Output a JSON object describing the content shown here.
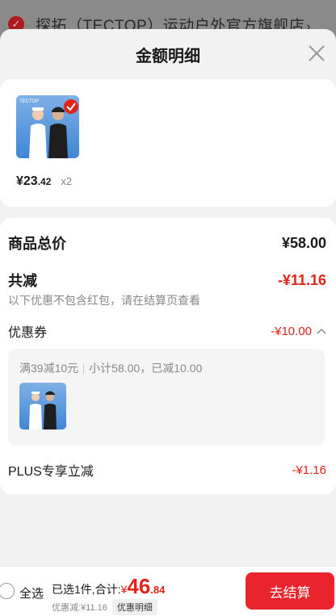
{
  "background_store": {
    "name": "探拓（TECTOP）运动户外官方旗舰店",
    "chevron": "›"
  },
  "sheet": {
    "title": "金额明细"
  },
  "product": {
    "price_main": "¥23",
    "price_decimal": ".42",
    "quantity": "x2",
    "thumb_brand": "TECTOP"
  },
  "summary": {
    "total_label": "商品总价",
    "total_value": "¥58.00",
    "reduce_label": "共减",
    "reduce_value": "-¥11.16",
    "note": "以下优惠不包含红包，请在结算页查看",
    "coupon_label": "优惠券",
    "coupon_value": "-¥10.00",
    "coupon_rule": "满39减10元",
    "coupon_subtotal": "小计58.00，已减10.00",
    "plus_label": "PLUS专享立减",
    "plus_value": "-¥1.16"
  },
  "bottom_bar": {
    "select_all": "全选",
    "selected_prefix": "已选1件,合计:",
    "yen": "¥",
    "amount_main": "46",
    "amount_decimal": ".84",
    "discount_text": "优惠减:¥11.16",
    "detail_chip": "优惠明细",
    "checkout": "去结算"
  },
  "colors": {
    "accent_red": "#e2231a",
    "checkout_red": "#e9242c"
  }
}
